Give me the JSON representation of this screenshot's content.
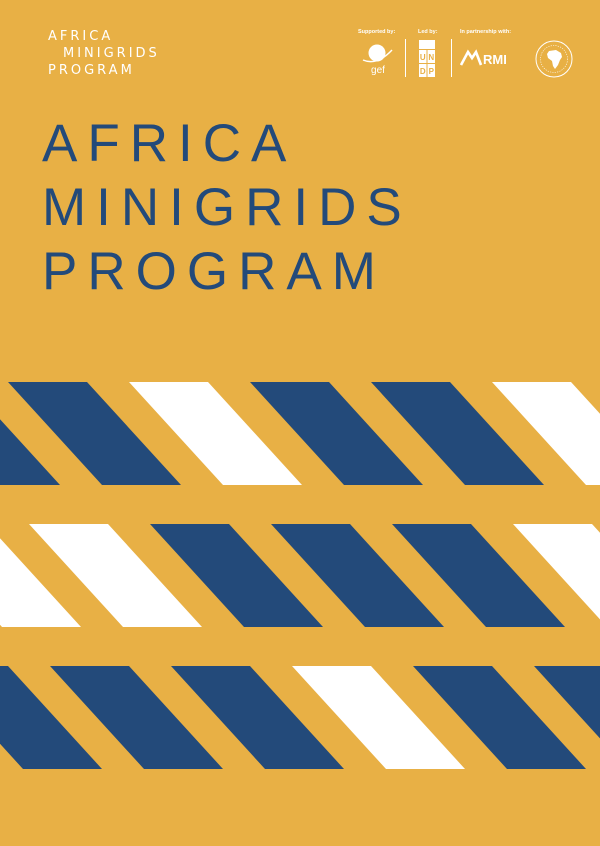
{
  "brand": {
    "line1": "AFRICA",
    "line2": "MINIGRIDS",
    "line3": "PROGRAM"
  },
  "partners": {
    "supported_by": "Supported by:",
    "led_by": "Led by:",
    "in_partnership_with": "In partnership with:",
    "gef": "gef",
    "undp": [
      "U",
      "N",
      "D",
      "P"
    ],
    "armi": "RMI"
  },
  "title": {
    "line1": "AFRICA",
    "line2": "MINIGRIDS",
    "line3": "PROGRAM"
  },
  "colors": {
    "background": "#e8b045",
    "navy": "#234a7a",
    "white": "#ffffff"
  },
  "stripe_pattern": [
    [
      "navy",
      "white",
      "navy",
      "navy",
      "white"
    ],
    [
      "white",
      "navy",
      "navy",
      "navy",
      "white",
      "navy"
    ],
    [
      "navy",
      "navy",
      "white",
      "navy",
      "navy",
      "navy"
    ]
  ]
}
